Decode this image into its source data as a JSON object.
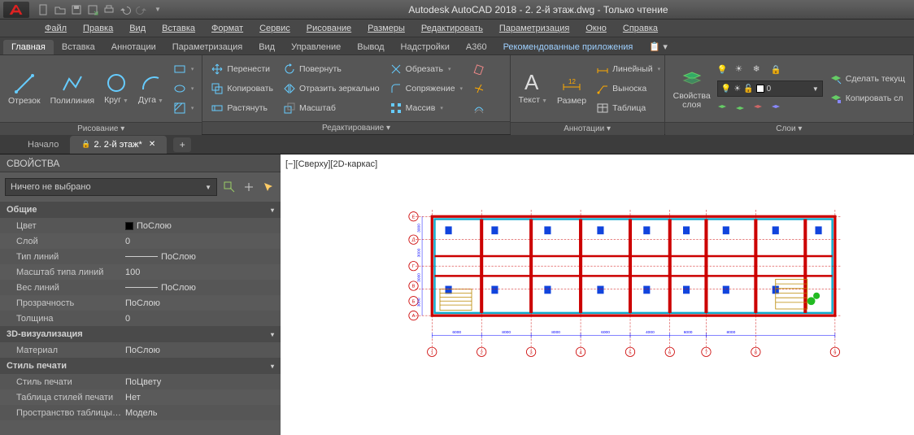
{
  "title": "Autodesk AutoCAD 2018 - 2. 2-й этаж.dwg - Только чтение",
  "menus": [
    "Файл",
    "Правка",
    "Вид",
    "Вставка",
    "Формат",
    "Сервис",
    "Рисование",
    "Размеры",
    "Редактировать",
    "Параметризация",
    "Окно",
    "Справка"
  ],
  "ribbon_tabs": [
    "Главная",
    "Вставка",
    "Аннотации",
    "Параметризация",
    "Вид",
    "Управление",
    "Вывод",
    "Надстройки",
    "A360",
    "Рекомендованные приложения"
  ],
  "ribbon_active": 0,
  "panels": {
    "draw": {
      "title": "Рисование ▾",
      "items": [
        "Отрезок",
        "Полилиния",
        "Круг",
        "Дуга"
      ]
    },
    "modify": {
      "title": "Редактирование ▾",
      "row1": [
        "Перенести",
        "Повернуть",
        "Обрезать"
      ],
      "row2": [
        "Копировать",
        "Отразить зеркально",
        "Сопряжение"
      ],
      "row3": [
        "Растянуть",
        "Масштаб",
        "Массив"
      ]
    },
    "annotation": {
      "title": "Аннотации ▾",
      "big": [
        "Текст",
        "Размер"
      ],
      "rows": [
        "Линейный",
        "Выноска",
        "Таблица"
      ]
    },
    "layers": {
      "title": "Слои ▾",
      "big": "Свойства\nслоя",
      "sel": "0",
      "right": [
        "Сделать текущ",
        "Копировать сл"
      ]
    }
  },
  "doc_tabs": {
    "inactive": "Начало",
    "active": "2. 2-й этаж*"
  },
  "props": {
    "header": "СВОЙСТВА",
    "selection": "Ничего не выбрано",
    "sections": [
      {
        "title": "Общие",
        "rows": [
          {
            "k": "Цвет",
            "v": "ПоСлою",
            "swatch": "#000"
          },
          {
            "k": "Слой",
            "v": "0"
          },
          {
            "k": "Тип линий",
            "v": "ПоСлою",
            "line": "solid"
          },
          {
            "k": "Масштаб типа линий",
            "v": "100"
          },
          {
            "k": "Вес линий",
            "v": "ПоСлою",
            "line": "solid"
          },
          {
            "k": "Прозрачность",
            "v": "ПоСлою"
          },
          {
            "k": "Толщина",
            "v": "0"
          }
        ]
      },
      {
        "title": "3D-визуализация",
        "rows": [
          {
            "k": "Материал",
            "v": "ПоСлою"
          }
        ]
      },
      {
        "title": "Стиль печати",
        "rows": [
          {
            "k": "Стиль печати",
            "v": "ПоЦвету"
          },
          {
            "k": "Таблица стилей печати",
            "v": "Нет"
          },
          {
            "k": "Пространство таблицы стил...",
            "v": "Модель"
          }
        ]
      }
    ]
  },
  "canvas": {
    "view_label": "[−][Сверху][2D-каркас]",
    "col_axes": [
      "1",
      "2",
      "3",
      "4",
      "5",
      "6",
      "7",
      "8",
      "9"
    ],
    "row_axes": [
      "А",
      "Б",
      "В",
      "Г",
      "Д",
      "Е"
    ],
    "dims_h": [
      "6000",
      "8000",
      "8000",
      "6000",
      "4000",
      "6000",
      "8000"
    ],
    "dims_v": [
      "3000",
      "3000",
      "3000",
      "3000"
    ]
  }
}
